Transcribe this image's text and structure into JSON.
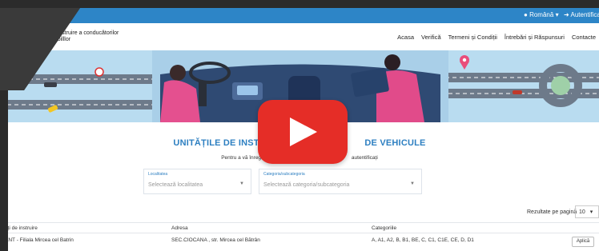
{
  "topbar": {
    "language": "Română",
    "login": "Autentificare"
  },
  "header": {
    "org_line1": "de instruire a conducătorilor",
    "org_line2": "mobilllor",
    "nav": [
      "Acasa",
      "Verifică",
      "Termeni și Condiții",
      "Întrebări și Răspunsuri",
      "Contacte"
    ]
  },
  "main": {
    "title_left": "UNITĂȚILE DE INSTRUIR",
    "title_right": "DE VEHICULE",
    "subtitle_left": "Pentru a vă înregistra la o unit",
    "subtitle_right": "autentificați"
  },
  "filters": {
    "locality": {
      "label": "Localitatea",
      "placeholder": "Selectează localitatea"
    },
    "category": {
      "label": "Categoria/subcategoria",
      "placeholder": "Selectează categoria/subcategoria"
    }
  },
  "results": {
    "label": "Rezultate pe pagină",
    "value": "10"
  },
  "table": {
    "headers": [
      "ăți de instruire",
      "Adresa",
      "Categoriile"
    ],
    "rows": [
      {
        "name": "ANT - Filiala Mircea cel Batrin",
        "address": "SEC.CIOCANA , str. Mircea cel Bătrân",
        "categories": "A, A1, A2, B, B1, BE, C, C1, C1E, CE, D, D1",
        "action": "Aplică"
      }
    ]
  },
  "colors": {
    "topbar": "#2d85c7",
    "accent": "#2d7fc1",
    "play": "#e52d27"
  }
}
